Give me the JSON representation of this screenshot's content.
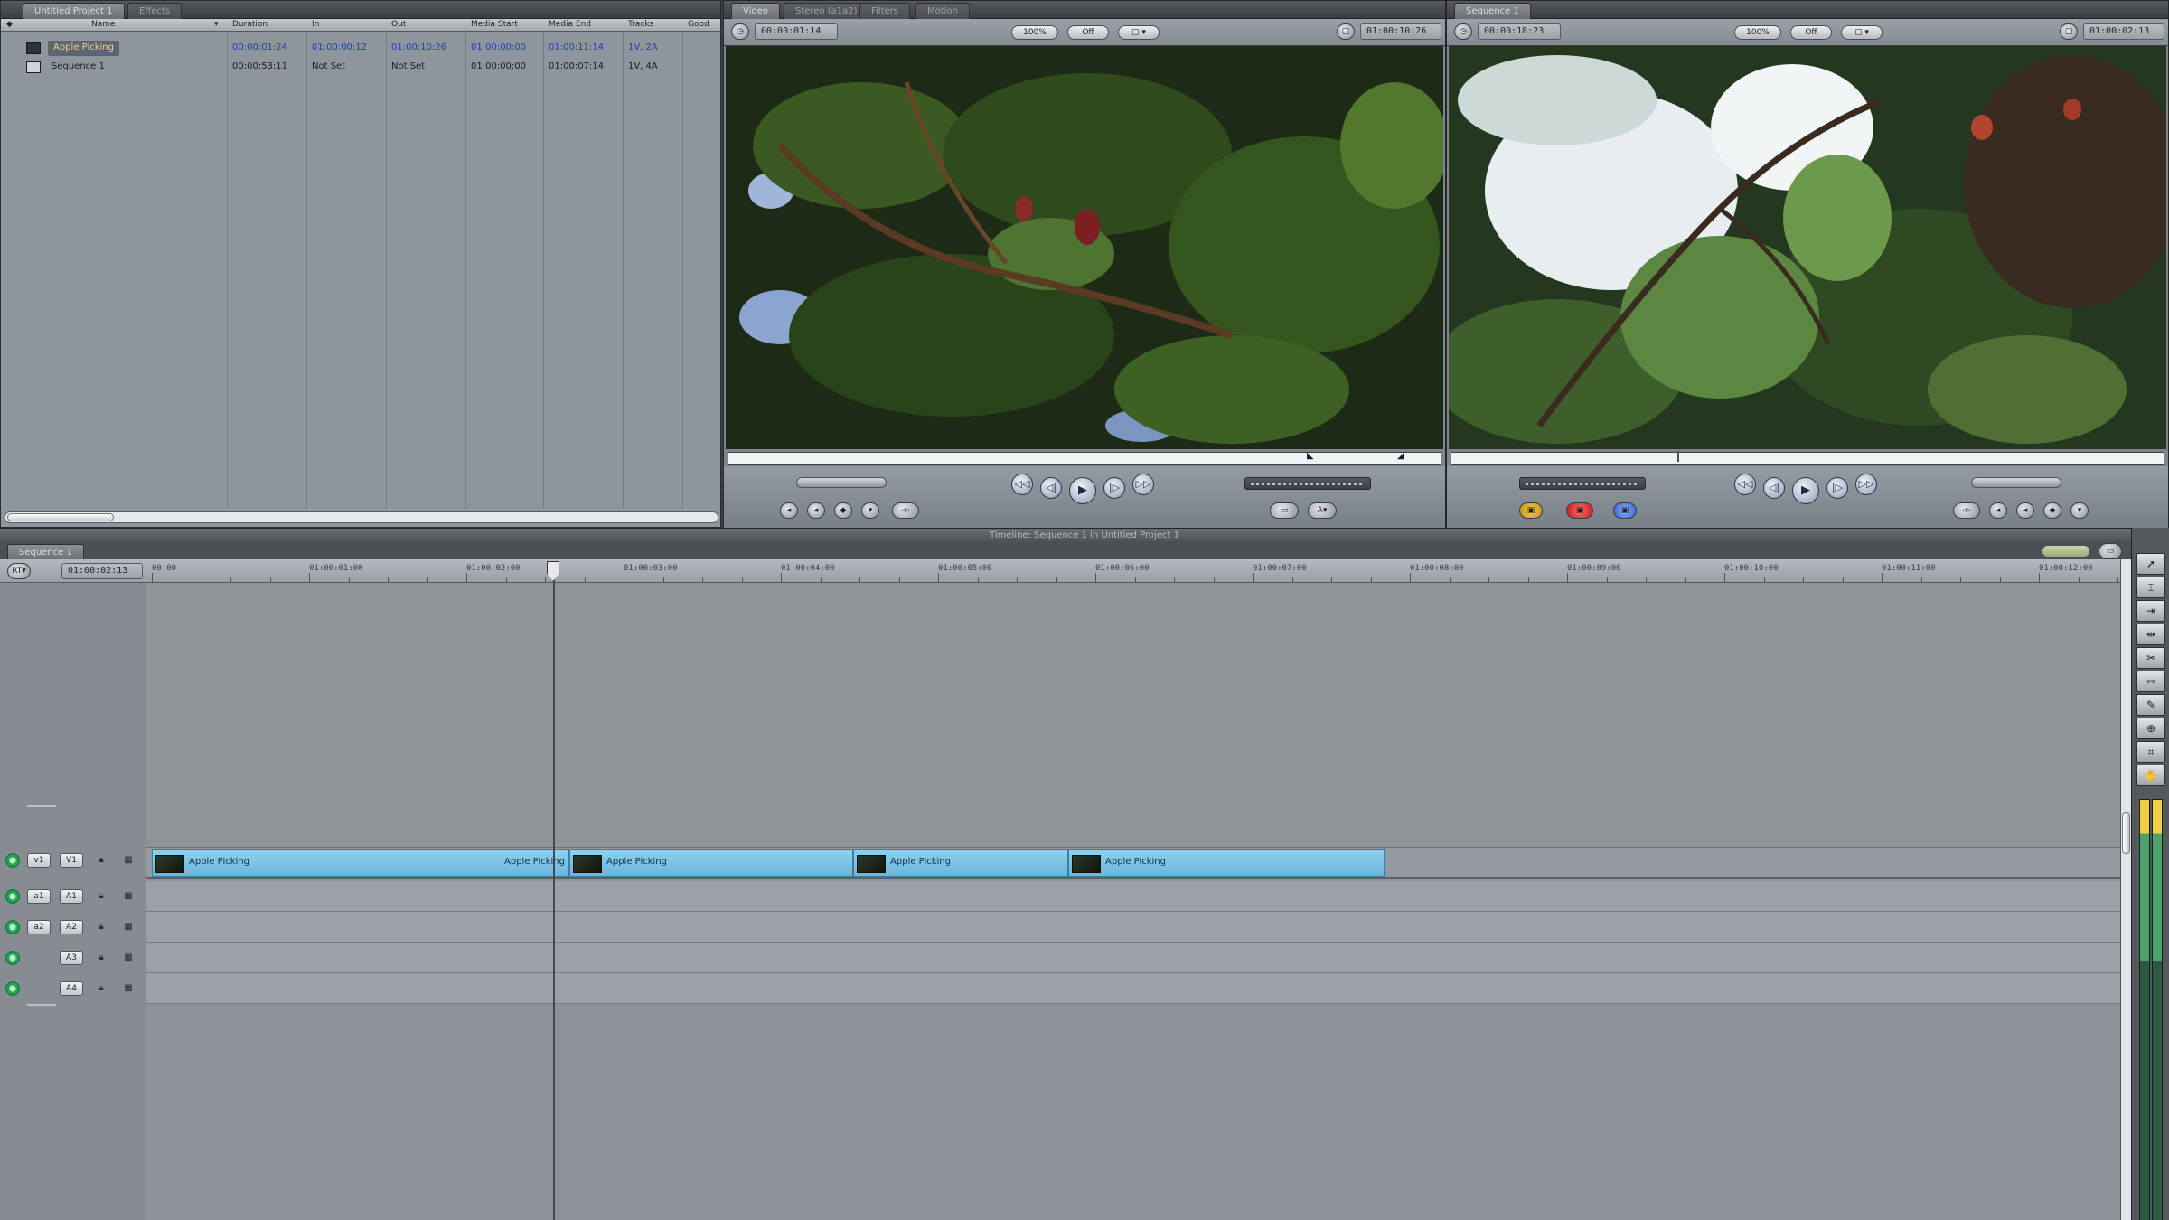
{
  "browser": {
    "tabs": [
      "Untitled Project 1",
      "Effects"
    ],
    "columns": [
      "Name",
      "Duration",
      "In",
      "Out",
      "Media Start",
      "Media End",
      "Tracks",
      "Good"
    ],
    "rows": [
      {
        "name": "Apple Picking",
        "duration": "00:00:01:24",
        "in": "01:00:00:12",
        "out": "01:00:10:26",
        "media_start": "01:00:00:00",
        "media_end": "01:00:11:14",
        "tracks": "1V, 2A",
        "selected": true,
        "kind": "clip"
      },
      {
        "name": "Sequence 1",
        "duration": "00:00:53:11",
        "in": "Not Set",
        "out": "Not Set",
        "media_start": "01:00:00:00",
        "media_end": "01:00:07:14",
        "tracks": "1V, 4A",
        "selected": false,
        "kind": "sequence"
      }
    ]
  },
  "viewer": {
    "tabs": [
      "Video",
      "Stereo (a1a2)",
      "Filters",
      "Motion"
    ],
    "timecode_left": "00:00:01:14",
    "timecode_right": "01:00:10:26",
    "zoom": "100%",
    "view": "Off",
    "transport": [
      "◁◁",
      "◁|",
      "▶",
      "|▷",
      "▷▷"
    ]
  },
  "canvas": {
    "tabs": [
      "Sequence 1"
    ],
    "timecode_left": "00:00:18:23",
    "timecode_right": "01:00:02:13",
    "zoom": "100%",
    "view": "Off",
    "transport": [
      "◁◁",
      "◁|",
      "▶",
      "|▷",
      "▷▷"
    ]
  },
  "timeline": {
    "title": "Timeline: Sequence 1 in Untitled Project 1",
    "tab": "Sequence 1",
    "current_timecode": "01:00:02:13",
    "ruler": [
      "00:00",
      "01:00:01:00",
      "01:00:02:00",
      "01:00:03:00",
      "01:00:04:00",
      "01:00:05:00",
      "01:00:06:00",
      "01:00:07:00",
      "01:00:08:00",
      "01:00:09:00",
      "01:00:10:00",
      "01:00:11:00",
      "01:00:12:00"
    ],
    "video_tracks": [
      {
        "target": "v1",
        "name": "V1"
      }
    ],
    "audio_tracks": [
      {
        "target": "a1",
        "name": "A1"
      },
      {
        "target": "a2",
        "name": "A2"
      },
      {
        "target": "",
        "name": "A3"
      },
      {
        "target": "",
        "name": "A4"
      }
    ],
    "clips": [
      {
        "name": "Apple Picking",
        "end_name": "Apple Picking"
      },
      {
        "name": "Apple Picking",
        "end_name": ""
      },
      {
        "name": "Apple Picking",
        "end_name": ""
      },
      {
        "name": "Apple Picking",
        "end_name": ""
      }
    ]
  },
  "tools": [
    "selection-icon",
    "edit-select-icon",
    "track-select-icon",
    "ripple-icon",
    "razor-icon",
    "slip-icon",
    "pen-icon",
    "zoom-icon",
    "crop-icon",
    "hand-icon"
  ]
}
